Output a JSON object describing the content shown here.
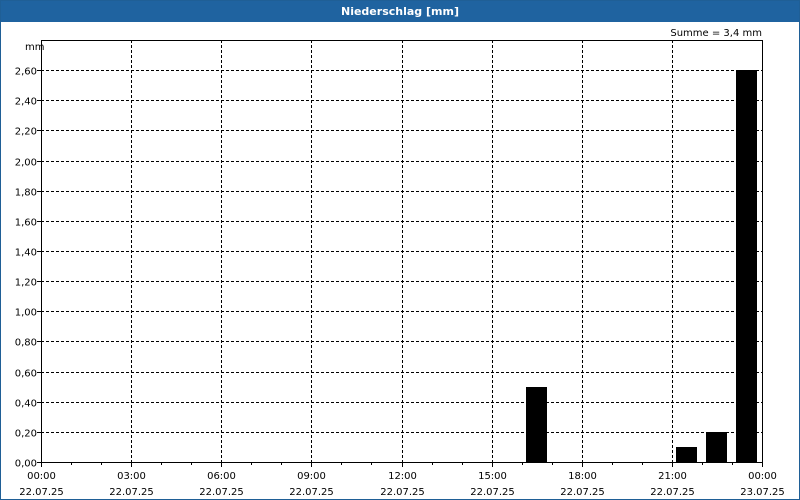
{
  "window": {
    "title": "Niederschlag [mm]"
  },
  "chart_data": {
    "type": "bar",
    "title": "Niederschlag [mm]",
    "ylabel": "mm",
    "annotation": "Summe = 3,4 mm",
    "ylim": [
      0,
      2.8
    ],
    "xlim_hours": [
      0,
      24
    ],
    "y_ticks": [
      {
        "value": 0.0,
        "label": "0,00"
      },
      {
        "value": 0.2,
        "label": "0,20"
      },
      {
        "value": 0.4,
        "label": "0,40"
      },
      {
        "value": 0.6,
        "label": "0,60"
      },
      {
        "value": 0.8,
        "label": "0,80"
      },
      {
        "value": 1.0,
        "label": "1,00"
      },
      {
        "value": 1.2,
        "label": "1,20"
      },
      {
        "value": 1.4,
        "label": "1,40"
      },
      {
        "value": 1.6,
        "label": "1,60"
      },
      {
        "value": 1.8,
        "label": "1,80"
      },
      {
        "value": 2.0,
        "label": "2,00"
      },
      {
        "value": 2.2,
        "label": "2,20"
      },
      {
        "value": 2.4,
        "label": "2,40"
      },
      {
        "value": 2.6,
        "label": "2,60"
      }
    ],
    "x_ticks": [
      {
        "hour": 0,
        "time": "00:00",
        "date": "22.07.25"
      },
      {
        "hour": 3,
        "time": "03:00",
        "date": "22.07.25"
      },
      {
        "hour": 6,
        "time": "06:00",
        "date": "22.07.25"
      },
      {
        "hour": 9,
        "time": "09:00",
        "date": "22.07.25"
      },
      {
        "hour": 12,
        "time": "12:00",
        "date": "22.07.25"
      },
      {
        "hour": 15,
        "time": "15:00",
        "date": "22.07.25"
      },
      {
        "hour": 18,
        "time": "18:00",
        "date": "22.07.25"
      },
      {
        "hour": 21,
        "time": "21:00",
        "date": "22.07.25"
      },
      {
        "hour": 24,
        "time": "00:00",
        "date": "23.07.25"
      }
    ],
    "bars": [
      {
        "hour": 16,
        "value": 0.5
      },
      {
        "hour": 21,
        "value": 0.1
      },
      {
        "hour": 22,
        "value": 0.2
      },
      {
        "hour": 23,
        "value": 2.6
      }
    ],
    "grid": true,
    "bar_color": "#000000",
    "title_bar_color": "#1f63a0"
  }
}
